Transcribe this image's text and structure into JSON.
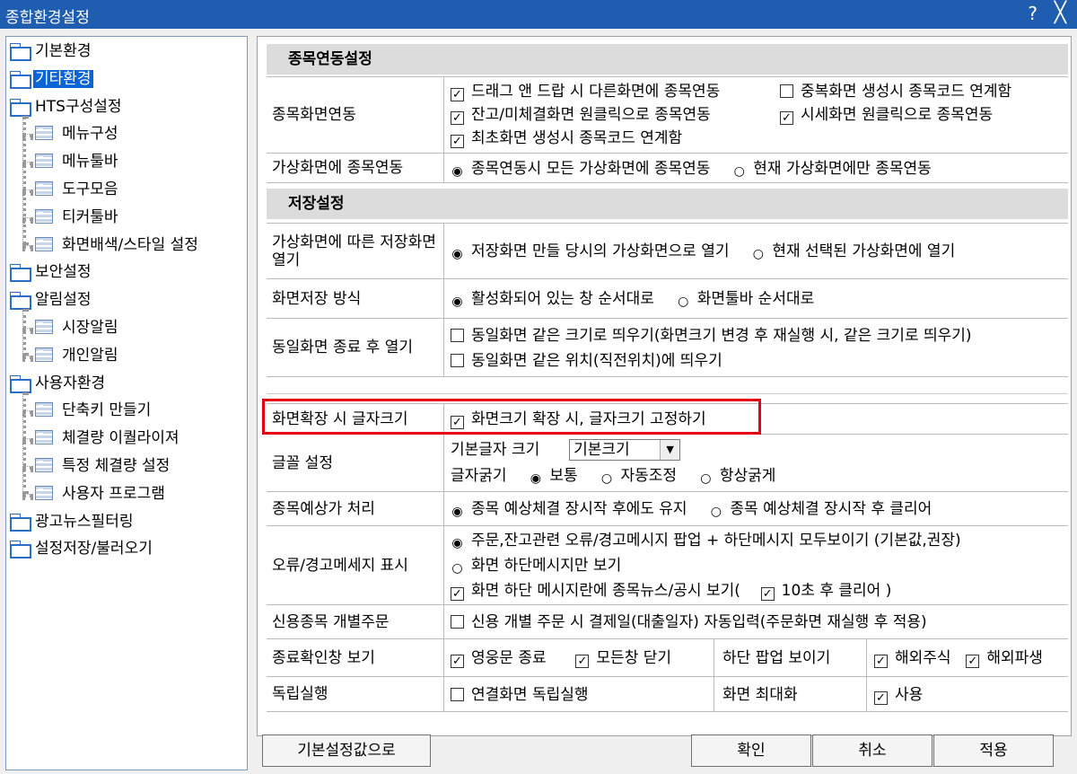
{
  "window": {
    "title": "종합환경설정",
    "help": "?",
    "close": "╳"
  },
  "tree": [
    {
      "label": "기본환경",
      "icon": "folder-icon",
      "level": 0
    },
    {
      "label": "기타환경",
      "icon": "folder-open-icon",
      "level": 0,
      "selected": true
    },
    {
      "label": "HTS구성설정",
      "icon": "folder-icon",
      "level": 0
    },
    {
      "label": "메뉴구성",
      "icon": "document-icon",
      "level": 1
    },
    {
      "label": "메뉴툴바",
      "icon": "document-icon",
      "level": 1
    },
    {
      "label": "도구모음",
      "icon": "document-icon",
      "level": 1
    },
    {
      "label": "티커툴바",
      "icon": "document-icon",
      "level": 1
    },
    {
      "label": "화면배색/스타일 설정",
      "icon": "document-icon",
      "level": 1
    },
    {
      "label": "보안설정",
      "icon": "folder-icon",
      "level": 0
    },
    {
      "label": "알림설정",
      "icon": "folder-icon",
      "level": 0
    },
    {
      "label": "시장알림",
      "icon": "document-icon",
      "level": 1
    },
    {
      "label": "개인알림",
      "icon": "document-icon",
      "level": 1
    },
    {
      "label": "사용자환경",
      "icon": "folder-icon",
      "level": 0
    },
    {
      "label": "단축키 만들기",
      "icon": "document-icon",
      "level": 1
    },
    {
      "label": "체결량 이퀄라이져",
      "icon": "document-icon",
      "level": 1
    },
    {
      "label": "특정 체결량 설정",
      "icon": "document-icon",
      "level": 1
    },
    {
      "label": "사용자 프로그램",
      "icon": "document-icon",
      "level": 1
    },
    {
      "label": "광고뉴스필터링",
      "icon": "folder-icon",
      "level": 0
    },
    {
      "label": "설정저장/불러오기",
      "icon": "folder-icon",
      "level": 0
    }
  ],
  "sections": {
    "link": "종목연동설정",
    "save": "저장설정"
  },
  "labels": {
    "r1": "종목화면연동",
    "r2": "가상화면에 종목연동",
    "r3": "가상화면에 따른 저장화면 열기",
    "r4": "화면저장 방식",
    "r5": "동일화면 종료 후 열기",
    "r6": "화면확장 시 글자크기",
    "r7": "글꼴 설정",
    "r8": "종목예상가 처리",
    "r9": "오류/경고메세지 표시",
    "r10": "신용종목 개별주문",
    "r11": "종료확인창 보기",
    "r11b": "하단 팝업 보이기",
    "r12": "독립실행",
    "r12b": "화면 최대화"
  },
  "options": {
    "o1": "드래그 앤 드랍 시 다른화면에 종목연동",
    "o2": "중복화면 생성시 종목코드 연계함",
    "o3": "잔고/미체결화면 원클릭으로 종목연동",
    "o4": "시세화면 원클릭으로 종목연동",
    "o5": "최초화면 생성시 종목코드 연계함",
    "o6": "종목연동시 모든 가상화면에 종목연동",
    "o7": "현재 가상화면에만 종목연동",
    "o8": "저장화면 만들 당시의 가상화면으로 열기",
    "o9": "현재 선택된 가상화면에 열기",
    "o10": "활성화되어 있는 창 순서대로",
    "o11": "화면툴바 순서대로",
    "o12": "동일화면 같은 크기로 띄우기(화면크기 변경 후 재실행 시, 같은 크기로 띄우기)",
    "o13": "동일화면 같은 위치(직전위치)에 띄우기",
    "o14": "화면크기 확장 시, 글자크기 고정하기",
    "o15": "기본글자 크기",
    "o15v": "기본크기",
    "o16": "글자굵기",
    "o17": "보통",
    "o18": "자동조정",
    "o19": "항상굵게",
    "o20": "종목 예상체결 장시작 후에도 유지",
    "o21": "종목 예상체결 장시작 후 클리어",
    "o22": "주문,잔고관련 오류/경고메시지 팝업 + 하단메시지 모두보이기 (기본값,권장)",
    "o23": "화면 하단메시지만 보기",
    "o24a": "화면 하단 메시지란에 종목뉴스/공시 보기(",
    "o24b": "10초 후 클리어 )",
    "o25": "신용 개별 주문 시 결제일(대출일자) 자동입력(주문화면 재실행 후 적용)",
    "o26": "영웅문 종료",
    "o27": "모든창 닫기",
    "o28": "해외주식",
    "o29": "해외파생",
    "o30": "연결화면 독립실행",
    "o31": "사용"
  },
  "buttons": {
    "default": "기본설정값으로",
    "ok": "확인",
    "cancel": "취소",
    "apply": "적용"
  }
}
